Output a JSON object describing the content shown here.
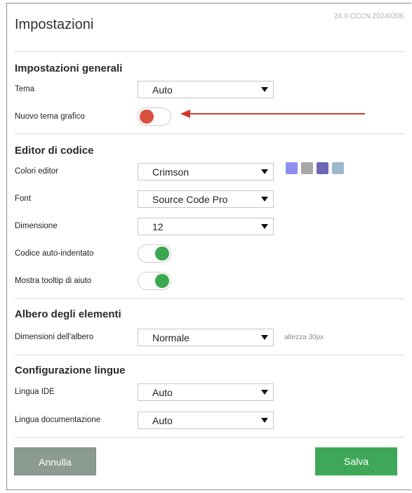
{
  "dialog": {
    "title": "Impostazioni",
    "version": "24.0-CCCN.20240206"
  },
  "general": {
    "section_title": "Impostazioni generali",
    "theme_label": "Tema",
    "theme_value": "Auto",
    "new_theme_label": "Nuovo tema grafico",
    "new_theme_enabled": false
  },
  "code_editor": {
    "section_title": "Editor di codice",
    "colors_label": "Colori editor",
    "colors_value": "Crimson",
    "swatches": [
      "#8f8ff0",
      "#a7a7a7",
      "#6c67b6",
      "#9db9cc"
    ],
    "font_label": "Font",
    "font_value": "Source Code Pro",
    "size_label": "Dimensione",
    "size_value": "12",
    "auto_indent_label": "Codice auto-indentato",
    "auto_indent_enabled": true,
    "tooltip_label": "Mostra tooltip di aiuto",
    "tooltip_enabled": true
  },
  "tree": {
    "section_title": "Albero degli elementi",
    "size_label": "Dimensioni dell'albero",
    "size_value": "Normale",
    "size_hint": "altezza 30px"
  },
  "languages": {
    "section_title": "Configurazione lingue",
    "ide_label": "Lingua IDE",
    "ide_value": "Auto",
    "doc_label": "Lingua documentazione",
    "doc_value": "Auto"
  },
  "footer": {
    "cancel_label": "Annulla",
    "save_label": "Salva"
  },
  "colors": {
    "accent_red": "#d33a2c",
    "toggle_off": "#d9503f",
    "toggle_on": "#3aa84e",
    "save_button": "#3fa858",
    "cancel_button": "#8b9b91"
  }
}
